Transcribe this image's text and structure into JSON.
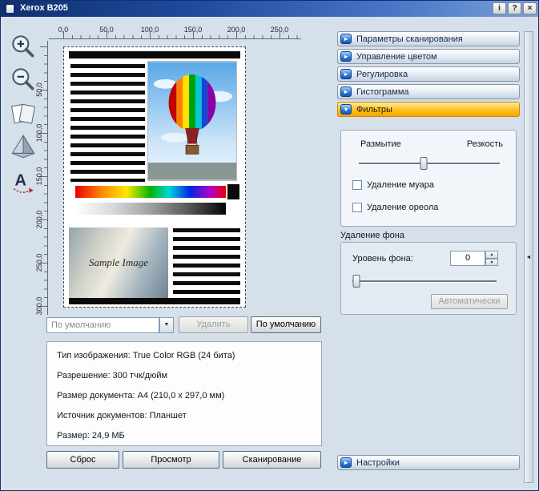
{
  "window": {
    "title": "Xerox B205"
  },
  "icons": {
    "info": "i",
    "help": "?",
    "close": "×",
    "combo_arrow": "▼",
    "spin_up": "▲",
    "spin_down": "▼",
    "collapse_arrow": "◄",
    "accordion_collapsed": "▸",
    "accordion_expanded": "▾"
  },
  "rulers": {
    "horizontal": [
      "0,0",
      "50,0",
      "100,0",
      "150,0",
      "200,0",
      "250,0"
    ],
    "vertical": [
      "50,0",
      "100,0",
      "150,0",
      "200,0",
      "250,0",
      "300,0"
    ]
  },
  "preview": {
    "sample_text": "Sample Image"
  },
  "preset_bar": {
    "preset_value": "По умолчанию",
    "delete_button": "Удалить",
    "default_button": "По умолчанию"
  },
  "info_box": {
    "lines": [
      "Тип изображения: True Color RGB (24 бита)",
      "Разрешение: 300 тчк/дюйм",
      "Размер документа: A4 (210,0 x 297,0 мм)",
      "Источник документов: Планшет",
      "Размер: 24,9 МБ"
    ]
  },
  "actions": {
    "reset": "Сброс",
    "preview": "Просмотр",
    "scan": "Сканирование"
  },
  "accordion": {
    "sections": [
      {
        "label": "Параметры сканирования",
        "expanded": false
      },
      {
        "label": "Управление цветом",
        "expanded": false
      },
      {
        "label": "Регулировка",
        "expanded": false
      },
      {
        "label": "Гистограмма",
        "expanded": false
      },
      {
        "label": "Фильтры",
        "expanded": true
      }
    ],
    "settings": "Настройки"
  },
  "filters": {
    "blur_label": "Размытие",
    "sharpness_label": "Резкость",
    "blur_sharp_slider_percent": 46,
    "moire_checkbox": {
      "label": "Удаление муара",
      "checked": false
    },
    "halo_checkbox": {
      "label": "Удаление ореола",
      "checked": false
    },
    "background": {
      "group_title": "Удаление фона",
      "level_label": "Уровень фона:",
      "level_value": "0",
      "level_slider_percent": 3,
      "auto_button": "Автоматически"
    }
  },
  "colors": {
    "accent_orange": "#ffb400",
    "titlebar_left": "#10306e",
    "titlebar_right": "#7aa2d8",
    "background": "#d6e0ea"
  }
}
